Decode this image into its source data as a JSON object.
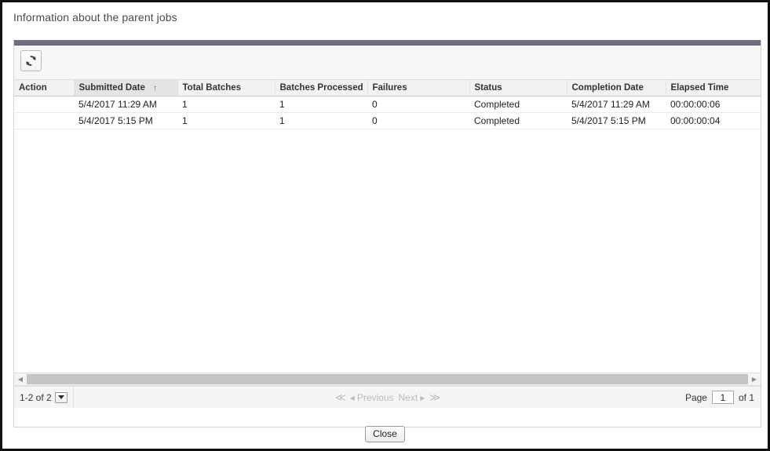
{
  "page": {
    "title": "Information about the parent jobs"
  },
  "toolbar": {
    "refresh_label": "Refresh",
    "refresh_icon": "refresh-icon"
  },
  "grid": {
    "sort_column": "Submitted Date",
    "sort_direction_glyph": "↑",
    "columns": [
      {
        "key": "action",
        "label": "Action"
      },
      {
        "key": "submitted",
        "label": "Submitted Date"
      },
      {
        "key": "total",
        "label": "Total Batches"
      },
      {
        "key": "processed",
        "label": "Batches Processed"
      },
      {
        "key": "failures",
        "label": "Failures"
      },
      {
        "key": "status",
        "label": "Status"
      },
      {
        "key": "completion",
        "label": "Completion Date"
      },
      {
        "key": "elapsed",
        "label": "Elapsed Time"
      }
    ],
    "rows": [
      {
        "action": "",
        "submitted": "5/4/2017 11:29 AM",
        "total": "1",
        "processed": "1",
        "failures": "0",
        "status": "Completed",
        "completion": "5/4/2017 11:29 AM",
        "elapsed": "00:00:00:06"
      },
      {
        "action": "",
        "submitted": "5/4/2017 5:15 PM",
        "total": "1",
        "processed": "1",
        "failures": "0",
        "status": "Completed",
        "completion": "5/4/2017 5:15 PM",
        "elapsed": "00:00:00:04"
      }
    ]
  },
  "footer": {
    "range_label": "1-2 of 2",
    "first_glyph": "≪",
    "prev_glyph": "◂",
    "prev_label": "Previous",
    "next_label": "Next",
    "next_glyph": "▸",
    "last_glyph": "≫",
    "page_label": "Page",
    "page_value": "1",
    "of_label": "of 1"
  },
  "actions": {
    "close_label": "Close"
  },
  "colors": {
    "grid_topbar": "#6e6e80",
    "header_bg": "#f2f2f2",
    "sorted_header_bg": "#e4e4e4",
    "scrollbar_thumb": "#c4c4c4",
    "disabled_text": "#b9b9b9",
    "frame": "#111111"
  }
}
